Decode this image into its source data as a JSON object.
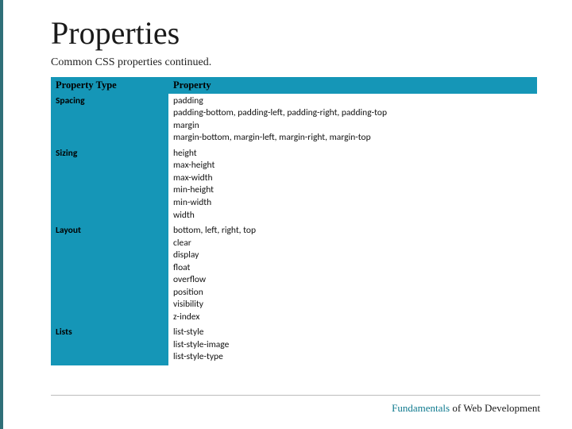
{
  "title": "Properties",
  "subtitle": "Common CSS properties continued.",
  "headers": {
    "col1": "Property Type",
    "col2": "Property"
  },
  "rows": [
    {
      "category": "Spacing",
      "properties": [
        "padding",
        "padding-bottom, padding-left, padding-right, padding-top",
        "margin",
        "margin-bottom, margin-left, margin-right, margin-top"
      ]
    },
    {
      "category": "Sizing",
      "properties": [
        "height",
        "max-height",
        "max-width",
        "min-height",
        "min-width",
        "width"
      ]
    },
    {
      "category": "Layout",
      "properties": [
        "bottom, left, right, top",
        "clear",
        "display",
        "float",
        "overflow",
        "position",
        "visibility",
        "z-index"
      ]
    },
    {
      "category": "Lists",
      "properties": [
        "list-style",
        "list-style-image",
        "list-style-type"
      ]
    }
  ],
  "footer": {
    "brand": "Fundamentals",
    "rest": " of Web Development"
  }
}
